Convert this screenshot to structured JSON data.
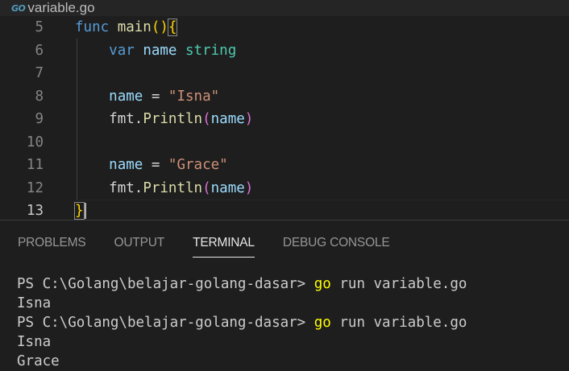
{
  "tab": {
    "icon": "go-icon",
    "icon_text": "GO",
    "filename": "variable.go"
  },
  "editor": {
    "lines": [
      {
        "num": "5",
        "tokens": [
          [
            "kw",
            "func"
          ],
          [
            "txt",
            " "
          ],
          [
            "fn",
            "main"
          ],
          [
            "br1",
            "()"
          ],
          [
            "br1",
            "{"
          ]
        ]
      },
      {
        "num": "6",
        "tokens": [
          [
            "txt",
            "    "
          ],
          [
            "kw",
            "var"
          ],
          [
            "txt",
            " "
          ],
          [
            "var",
            "name"
          ],
          [
            "txt",
            " "
          ],
          [
            "type",
            "string"
          ]
        ]
      },
      {
        "num": "7",
        "tokens": []
      },
      {
        "num": "8",
        "tokens": [
          [
            "txt",
            "    "
          ],
          [
            "var",
            "name"
          ],
          [
            "txt",
            " = "
          ],
          [
            "str",
            "\"Isna\""
          ]
        ]
      },
      {
        "num": "9",
        "tokens": [
          [
            "txt",
            "    "
          ],
          [
            "txt",
            "fmt."
          ],
          [
            "fn",
            "Println"
          ],
          [
            "br2",
            "("
          ],
          [
            "var",
            "name"
          ],
          [
            "br2",
            ")"
          ]
        ]
      },
      {
        "num": "10",
        "tokens": []
      },
      {
        "num": "11",
        "tokens": [
          [
            "txt",
            "    "
          ],
          [
            "var",
            "name"
          ],
          [
            "txt",
            " = "
          ],
          [
            "str",
            "\"Grace\""
          ]
        ]
      },
      {
        "num": "12",
        "tokens": [
          [
            "txt",
            "    "
          ],
          [
            "txt",
            "fmt."
          ],
          [
            "fn",
            "Println"
          ],
          [
            "br2",
            "("
          ],
          [
            "var",
            "name"
          ],
          [
            "br2",
            ")"
          ]
        ]
      },
      {
        "num": "13",
        "tokens": [
          [
            "br1",
            "}"
          ]
        ]
      }
    ]
  },
  "panel": {
    "tabs": [
      {
        "label": "PROBLEMS",
        "active": false
      },
      {
        "label": "OUTPUT",
        "active": false
      },
      {
        "label": "TERMINAL",
        "active": true
      },
      {
        "label": "DEBUG CONSOLE",
        "active": false
      }
    ]
  },
  "terminal": {
    "lines": [
      {
        "prompt": "PS C:\\Golang\\belajar-golang-dasar> ",
        "cmd": "go",
        "rest": " run variable.go"
      },
      {
        "prompt": "",
        "cmd": "",
        "rest": "Isna"
      },
      {
        "prompt": "PS C:\\Golang\\belajar-golang-dasar> ",
        "cmd": "go",
        "rest": " run variable.go"
      },
      {
        "prompt": "",
        "cmd": "",
        "rest": "Isna"
      },
      {
        "prompt": "",
        "cmd": "",
        "rest": "Grace"
      }
    ]
  }
}
